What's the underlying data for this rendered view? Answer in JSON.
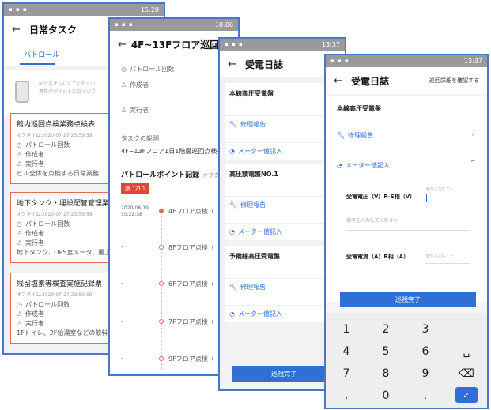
{
  "s1": {
    "status_time": "15:28",
    "title": "日常タスク",
    "tab": "パトロール",
    "nfc_line1": "NFCをオンにしてください",
    "nfc_line2": "携帯がポイントに近づいて",
    "cards": [
      {
        "title": "館内巡回点検業務点検表",
        "sub": "オフタイム:2020-07-27 23:59:59",
        "r1": "パトロール回数",
        "r2": "作成者",
        "r3": "実行者",
        "desc": "ビル全体を点検する日常業務"
      },
      {
        "title": "地下タンク・埋設配管管理業",
        "sub": "オフタイム:2020-07-27 23:59:59",
        "r1": "パトロール回数",
        "r2": "作成者",
        "r3": "実行者",
        "desc": "地下タンク、OPS室メータ、屋上"
      },
      {
        "title": "残留塩素等検査実施記録票",
        "sub": "オフタイム:2020-07-27 23:59:59",
        "r1": "パトロール回数",
        "r2": "作成者",
        "r3": "実行者",
        "desc": "1Fトイレ、2F給湯室などの飲料水"
      }
    ]
  },
  "s2": {
    "status_time": "18:06",
    "title": "4F~13Fフロア巡回...",
    "patrol_count": "パトロール回数",
    "creator": "作成者",
    "executor": "実行者",
    "desc_label": "タスクの説明",
    "desc": "4F~13Fフロア1日1階層巡回点検を",
    "section": "パトロールポイント記録",
    "offtime": "オフタイ",
    "badge": "康 1/10",
    "date": "2020-08-19",
    "time": "10:22:38",
    "dash": "-",
    "points": [
      "4Fフロア点検（",
      "8Fフロア点検（",
      "6Fフロア点検（",
      "7Fフロア点検（",
      "9Fフロア点検（"
    ]
  },
  "s3": {
    "status_time": "13:37",
    "title": "受電日誌",
    "sections": [
      {
        "title": "本線高圧受電盤",
        "repair": "修理報告",
        "meter": "メーター値記入"
      },
      {
        "title": "高圧饋電盤NO.1",
        "repair": "修理報告",
        "meter": "メーター値記入"
      },
      {
        "title": "予備線高圧受電盤",
        "repair": "修理報告",
        "meter": "メーター値記入"
      }
    ],
    "complete": "巡視完了"
  },
  "s4": {
    "status_time": "13:37",
    "title": "受電日誌",
    "detail_link": "巡回詳細を確認する",
    "section": "本線高圧受電盤",
    "repair": "修理報告",
    "meter": "メーター値記入",
    "field1_label": "受電電圧（V）R-S相（V）",
    "field1_placeholder": "値を入力して···",
    "note_placeholder": "備考を入力してください",
    "field2_label": "受電電流（A）R相（A）",
    "field2_placeholder": "値を入力して···",
    "complete": "巡視完了",
    "keys": [
      "1",
      "2",
      "3",
      "－",
      "4",
      "5",
      "6",
      "␣",
      "7",
      "8",
      "9",
      "⌫",
      ",",
      "0",
      ".",
      "✓"
    ]
  }
}
